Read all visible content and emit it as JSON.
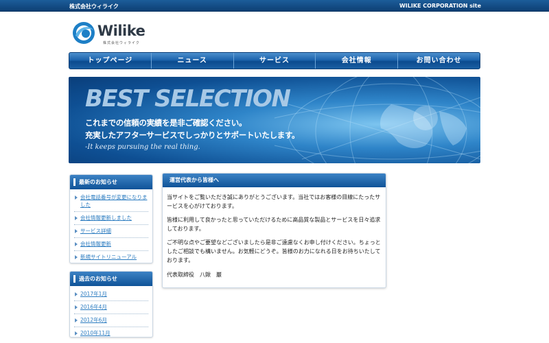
{
  "topbar": {
    "left_text": "株式会社ウィライク",
    "right_text": "WILIKE CORPORATION site"
  },
  "logo": {
    "name": "Wilike",
    "sub": "株式会社ウィライク"
  },
  "nav": {
    "items": [
      {
        "label": "トップページ"
      },
      {
        "label": "ニュース"
      },
      {
        "label": "サービス"
      },
      {
        "label": "会社情報"
      },
      {
        "label": "お問い合わせ"
      }
    ]
  },
  "banner": {
    "title": "BEST SELECTION",
    "line1": "これまでの信頼の実績を是非ご確認ください。",
    "line2": "充実したアフターサービスでしっかりとサポートいたします。",
    "tagline": "-It keeps pursuing the real thing."
  },
  "news": {
    "heading": "最新のお知らせ",
    "items": [
      {
        "label": "会社電話番号が変更になりました"
      },
      {
        "label": "会社情報更新しました"
      },
      {
        "label": "サービス詳細"
      },
      {
        "label": "会社情報更新"
      },
      {
        "label": "新規サイトリニューアル"
      }
    ]
  },
  "past": {
    "heading": "過去のお知らせ",
    "items": [
      {
        "label": "2017年1月"
      },
      {
        "label": "2016年4月"
      },
      {
        "label": "2012年6月"
      },
      {
        "label": "2010年11月"
      }
    ]
  },
  "message": {
    "heading": "運営代表から皆様へ",
    "p1": "当サイトをご覧いただき誠にありがとうございます。当社ではお客様の目線にたったサービスを心がけております。",
    "p2": "皆様に利用して良かったと思っていただけるために高品質な製品とサービスを日々追求しております。",
    "p3": "ご不明な点やご要望などございましたら是非ご遠慮なくお申し付けください。ちょっとしたご相談でも構いません。お気軽にどうぞ。皆様のお力になれる日をお待ちいたしております。",
    "signature": "代表取締役　八鍬　巌"
  },
  "colors": {
    "accent": "#0f5398",
    "link": "#2a7bc0",
    "topbar": "#1c5d9a"
  }
}
